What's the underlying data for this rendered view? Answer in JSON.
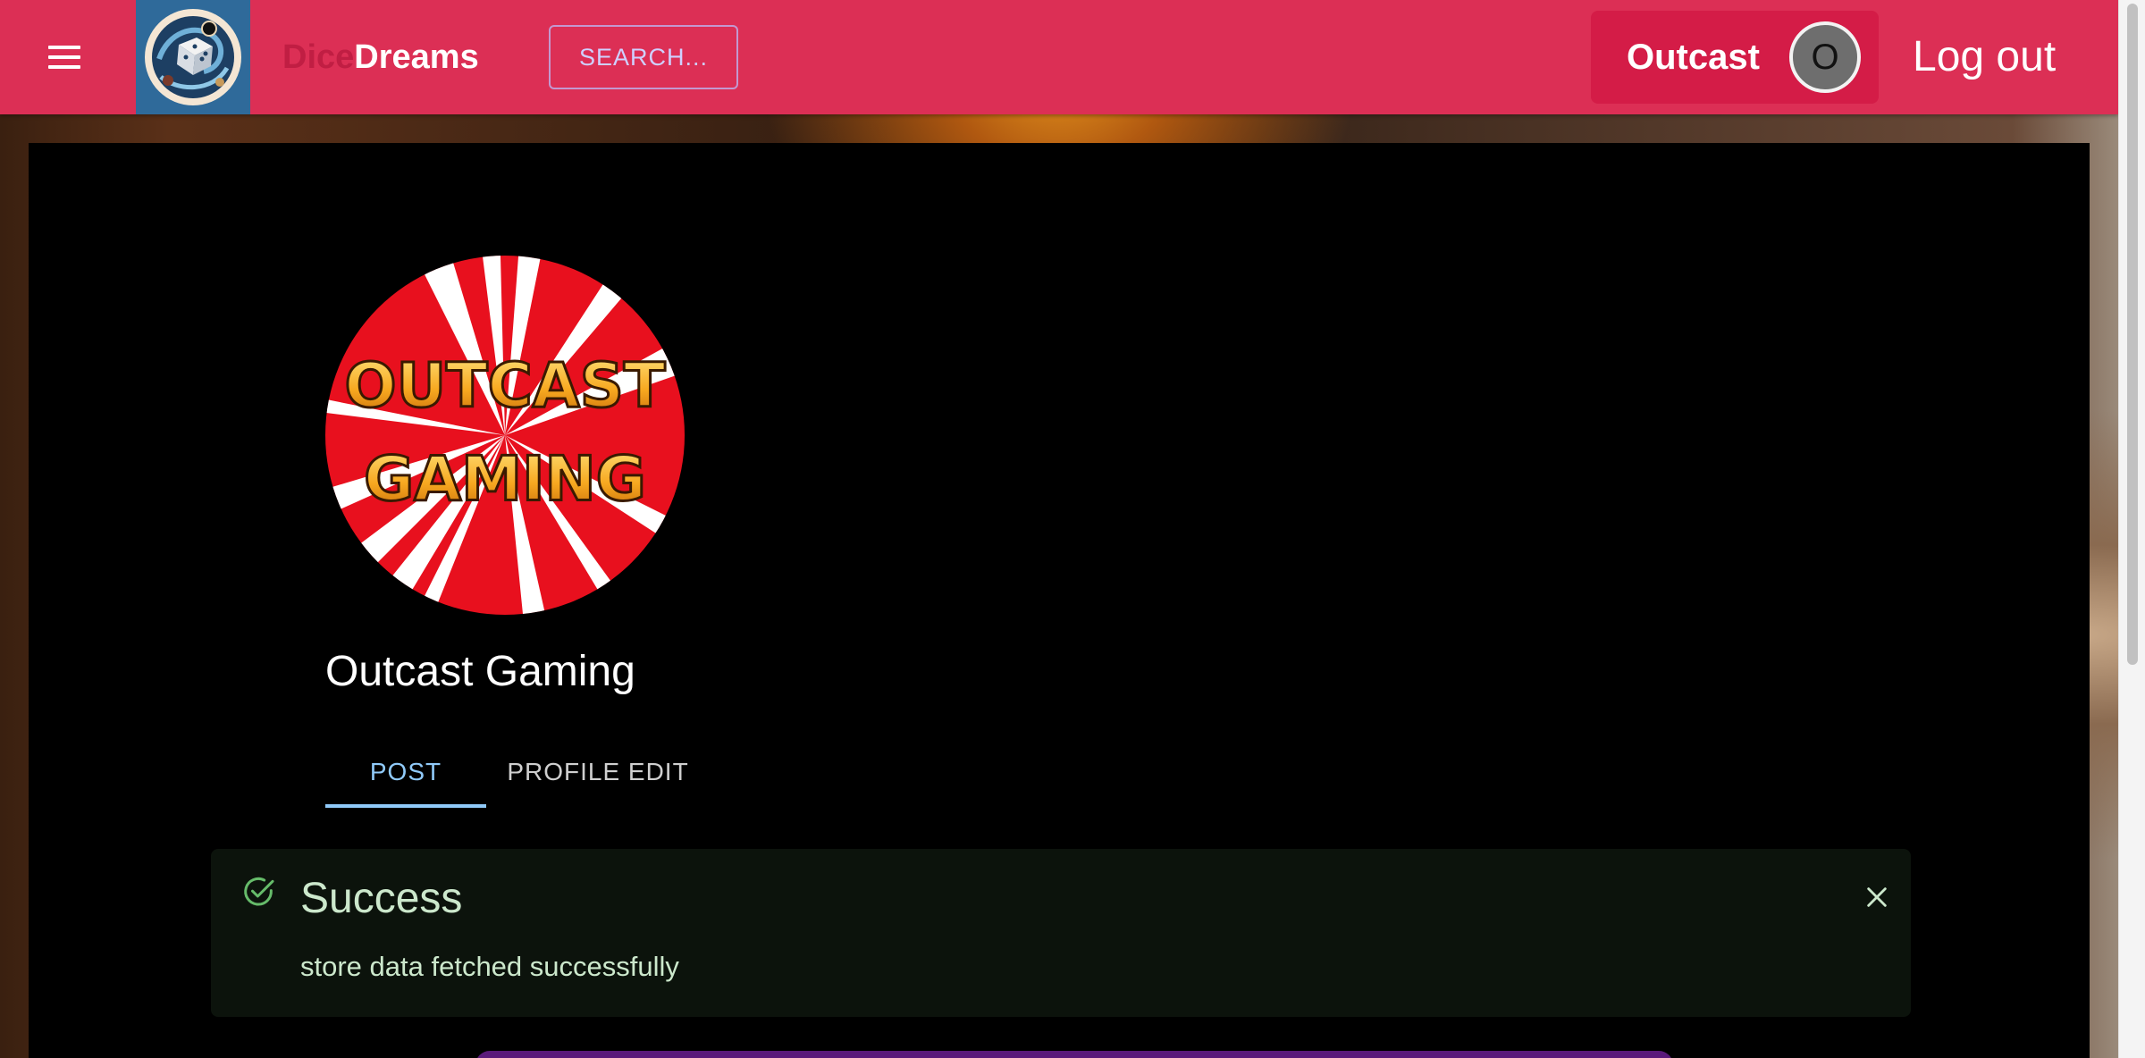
{
  "header": {
    "brand_part1": "Dice",
    "brand_part2": "Dreams",
    "search_label": "SEARCH...",
    "user_name": "Outcast",
    "user_initial": "O",
    "logout_label": "Log out",
    "menu_icon": "hamburger-icon",
    "logo_icon": "dice-swirl-logo",
    "colors": {
      "bar": "#dc2f55",
      "chip": "#d41c47",
      "brand_dim": "#c01e43"
    }
  },
  "profile": {
    "logo_line1": "OUTCAST",
    "logo_line2": "GAMING",
    "name": "Outcast Gaming"
  },
  "tabs": [
    {
      "label": "POST",
      "active": true
    },
    {
      "label": "PROFILE EDIT",
      "active": false
    }
  ],
  "alert": {
    "severity": "success",
    "title": "Success",
    "message": "store data fetched successfully",
    "icon": "check-circle-icon",
    "close_icon": "close-icon"
  }
}
